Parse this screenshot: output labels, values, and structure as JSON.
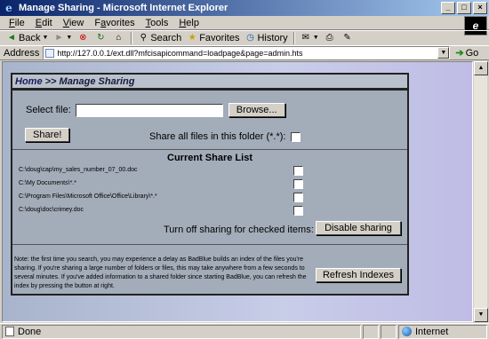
{
  "window": {
    "title": "Manage Sharing - Microsoft Internet Explorer",
    "minimize": "_",
    "maximize": "□",
    "close": "×"
  },
  "menubar": {
    "items": [
      {
        "key": "F",
        "rest": "ile"
      },
      {
        "key": "E",
        "rest": "dit"
      },
      {
        "key": "V",
        "rest": "iew"
      },
      {
        "key": "F",
        "rest": "avorites"
      },
      {
        "key": "T",
        "rest": "ools"
      },
      {
        "key": "H",
        "rest": "elp"
      }
    ]
  },
  "toolbar": {
    "back": "Back",
    "search": "Search",
    "favorites": "Favorites",
    "history": "History"
  },
  "address": {
    "label": "Address",
    "url": "http://127.0.0.1/ext.dll?mfcisapicommand=loadpage&page=admin.hts",
    "go": "Go"
  },
  "page": {
    "breadcrumb_home": "Home",
    "breadcrumb_sep": " >> ",
    "breadcrumb_current": "Manage Sharing",
    "select_file_label": "Select file:",
    "select_file_value": "",
    "browse_button": "Browse...",
    "share_button": "Share!",
    "share_all_label": "Share all files in this folder (*.*):",
    "share_list_title": "Current Share List",
    "share_list": [
      "C:\\doug\\cap\\my_sales_number_07_00.doc",
      "C:\\My Documents\\*.*",
      "C:\\Program Files\\Microsoft Office\\Office\\Library\\*.*",
      "C:\\doug\\doc\\crimey.doc"
    ],
    "turn_off_label": "Turn off sharing for checked items:",
    "disable_button": "Disable sharing",
    "note": "Note: the first time you search, you may experience a delay as BadBlue builds an index of the files you're sharing. If you're sharing a large number of folders or files, this may take anywhere from a few seconds to several minutes. If you've added information to a shared folder since starting BadBlue, you can refresh the index by pressing the button at right.",
    "refresh_button": "Refresh Indexes"
  },
  "statusbar": {
    "status": "Done",
    "zone": "Internet"
  }
}
